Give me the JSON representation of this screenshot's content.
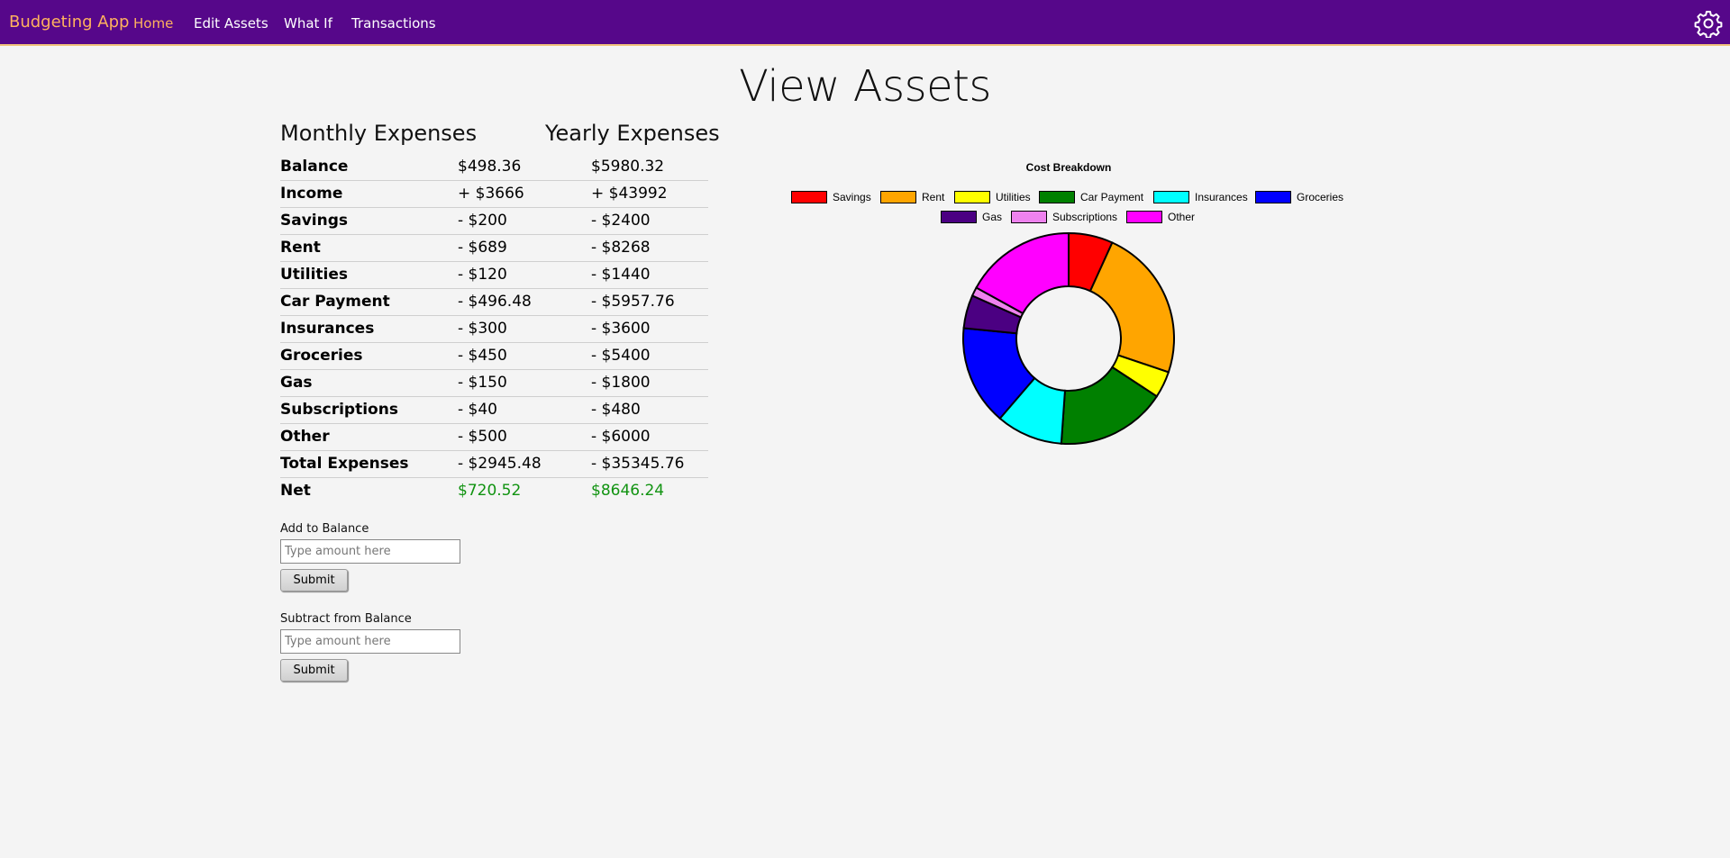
{
  "navbar": {
    "brand": "Budgeting App",
    "links": [
      "Home",
      "Edit Assets",
      "What If",
      "Transactions"
    ],
    "active": "Home",
    "settings_icon": "gear-icon"
  },
  "page": {
    "title": "View Assets"
  },
  "table": {
    "headers": {
      "monthly": "Monthly Expenses",
      "yearly": "Yearly Expenses"
    },
    "rows": [
      {
        "label": "Balance",
        "monthly": "$498.36",
        "yearly": "$5980.32"
      },
      {
        "label": "Income",
        "monthly": "+ $3666",
        "yearly": "+ $43992"
      },
      {
        "label": "Savings",
        "monthly": "- $200",
        "yearly": "- $2400"
      },
      {
        "label": "Rent",
        "monthly": "- $689",
        "yearly": "- $8268"
      },
      {
        "label": "Utilities",
        "monthly": "- $120",
        "yearly": "- $1440"
      },
      {
        "label": "Car Payment",
        "monthly": "- $496.48",
        "yearly": "- $5957.76"
      },
      {
        "label": "Insurances",
        "monthly": "- $300",
        "yearly": "- $3600"
      },
      {
        "label": "Groceries",
        "monthly": "- $450",
        "yearly": "- $5400"
      },
      {
        "label": "Gas",
        "monthly": "- $150",
        "yearly": "- $1800"
      },
      {
        "label": "Subscriptions",
        "monthly": "- $40",
        "yearly": "- $480"
      },
      {
        "label": "Other",
        "monthly": "- $500",
        "yearly": "- $6000"
      },
      {
        "label": "Total Expenses",
        "monthly": "- $2945.48",
        "yearly": "- $35345.76"
      },
      {
        "label": "Net",
        "monthly": "$720.52",
        "yearly": "$8646.24"
      }
    ],
    "net_color": "#119311"
  },
  "forms": {
    "add": {
      "label": "Add to Balance",
      "placeholder": "Type amount here",
      "button": "Submit"
    },
    "subtract": {
      "label": "Subtract from Balance",
      "placeholder": "Type amount here",
      "button": "Submit"
    }
  },
  "chart_data": {
    "type": "pie",
    "style": "doughnut",
    "title": "Cost Breakdown",
    "legend_position": "top",
    "categories": [
      "Savings",
      "Rent",
      "Utilities",
      "Car Payment",
      "Insurances",
      "Groceries",
      "Gas",
      "Subscriptions",
      "Other"
    ],
    "values": [
      200,
      689,
      120,
      496.48,
      300,
      450,
      150,
      40,
      500
    ],
    "colors": [
      "#ff0000",
      "#ffa500",
      "#ffff00",
      "#008000",
      "#00ffff",
      "#0000ff",
      "#4b0082",
      "#ee82ee",
      "#ff00ff"
    ]
  }
}
